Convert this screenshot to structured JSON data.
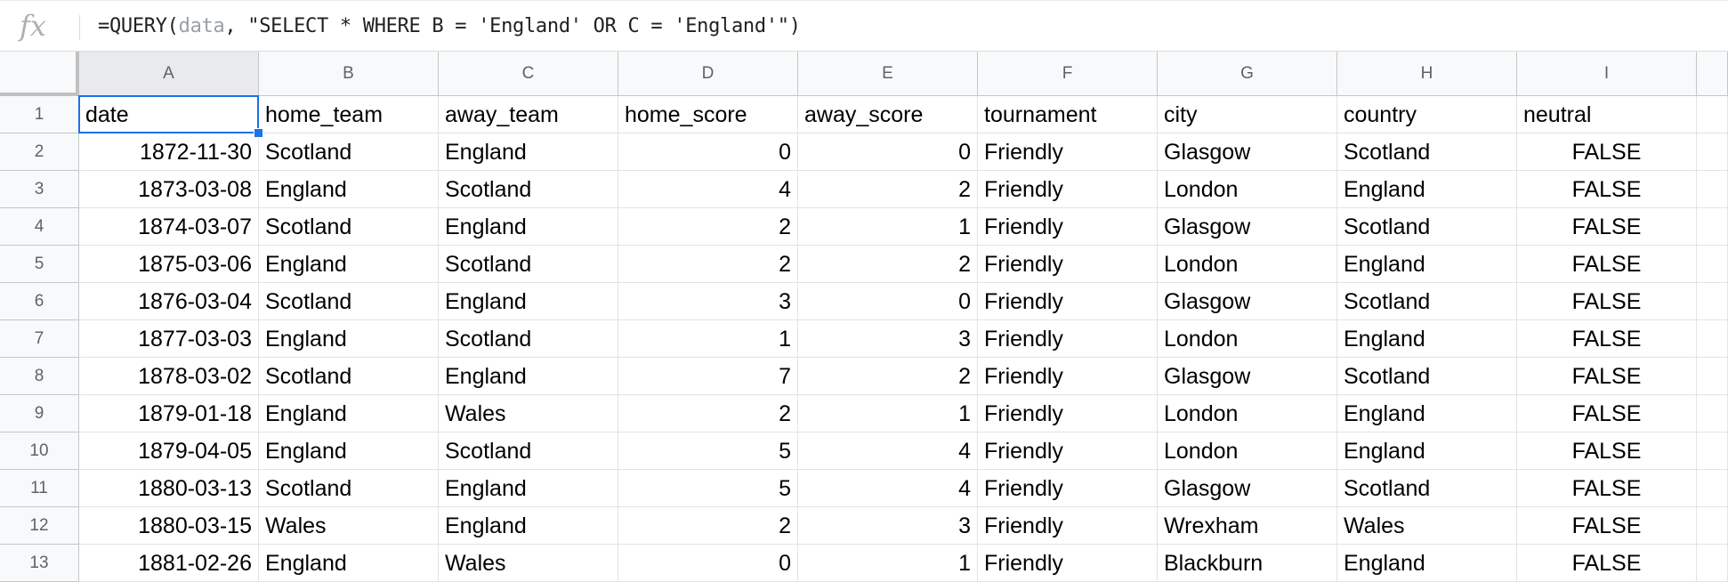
{
  "formula": {
    "icon": "fx-icon",
    "prefix": "=QUERY(",
    "range": "data",
    "rest": ", \"SELECT * WHERE B = 'England' OR C = 'England'\")"
  },
  "columns": [
    "A",
    "B",
    "C",
    "D",
    "E",
    "F",
    "G",
    "H",
    "I"
  ],
  "selected_column": "A",
  "rows": [
    {
      "n": "1",
      "cells": [
        "date",
        "home_team",
        "away_team",
        "home_score",
        "away_score",
        "tournament",
        "city",
        "country",
        "neutral"
      ]
    },
    {
      "n": "2",
      "cells": [
        "1872-11-30",
        "Scotland",
        "England",
        "0",
        "0",
        "Friendly",
        "Glasgow",
        "Scotland",
        "FALSE"
      ]
    },
    {
      "n": "3",
      "cells": [
        "1873-03-08",
        "England",
        "Scotland",
        "4",
        "2",
        "Friendly",
        "London",
        "England",
        "FALSE"
      ]
    },
    {
      "n": "4",
      "cells": [
        "1874-03-07",
        "Scotland",
        "England",
        "2",
        "1",
        "Friendly",
        "Glasgow",
        "Scotland",
        "FALSE"
      ]
    },
    {
      "n": "5",
      "cells": [
        "1875-03-06",
        "England",
        "Scotland",
        "2",
        "2",
        "Friendly",
        "London",
        "England",
        "FALSE"
      ]
    },
    {
      "n": "6",
      "cells": [
        "1876-03-04",
        "Scotland",
        "England",
        "3",
        "0",
        "Friendly",
        "Glasgow",
        "Scotland",
        "FALSE"
      ]
    },
    {
      "n": "7",
      "cells": [
        "1877-03-03",
        "England",
        "Scotland",
        "1",
        "3",
        "Friendly",
        "London",
        "England",
        "FALSE"
      ]
    },
    {
      "n": "8",
      "cells": [
        "1878-03-02",
        "Scotland",
        "England",
        "7",
        "2",
        "Friendly",
        "Glasgow",
        "Scotland",
        "FALSE"
      ]
    },
    {
      "n": "9",
      "cells": [
        "1879-01-18",
        "England",
        "Wales",
        "2",
        "1",
        "Friendly",
        "London",
        "England",
        "FALSE"
      ]
    },
    {
      "n": "10",
      "cells": [
        "1879-04-05",
        "England",
        "Scotland",
        "5",
        "4",
        "Friendly",
        "London",
        "England",
        "FALSE"
      ]
    },
    {
      "n": "11",
      "cells": [
        "1880-03-13",
        "Scotland",
        "England",
        "5",
        "4",
        "Friendly",
        "Glasgow",
        "Scotland",
        "FALSE"
      ]
    },
    {
      "n": "12",
      "cells": [
        "1880-03-15",
        "Wales",
        "England",
        "2",
        "3",
        "Friendly",
        "Wrexham",
        "Wales",
        "FALSE"
      ]
    },
    {
      "n": "13",
      "cells": [
        "1881-02-26",
        "England",
        "Wales",
        "0",
        "1",
        "Friendly",
        "Blackburn",
        "England",
        "FALSE"
      ]
    }
  ],
  "colors": {
    "selection": "#1a73e8",
    "header_bg": "#f8f9fa"
  }
}
